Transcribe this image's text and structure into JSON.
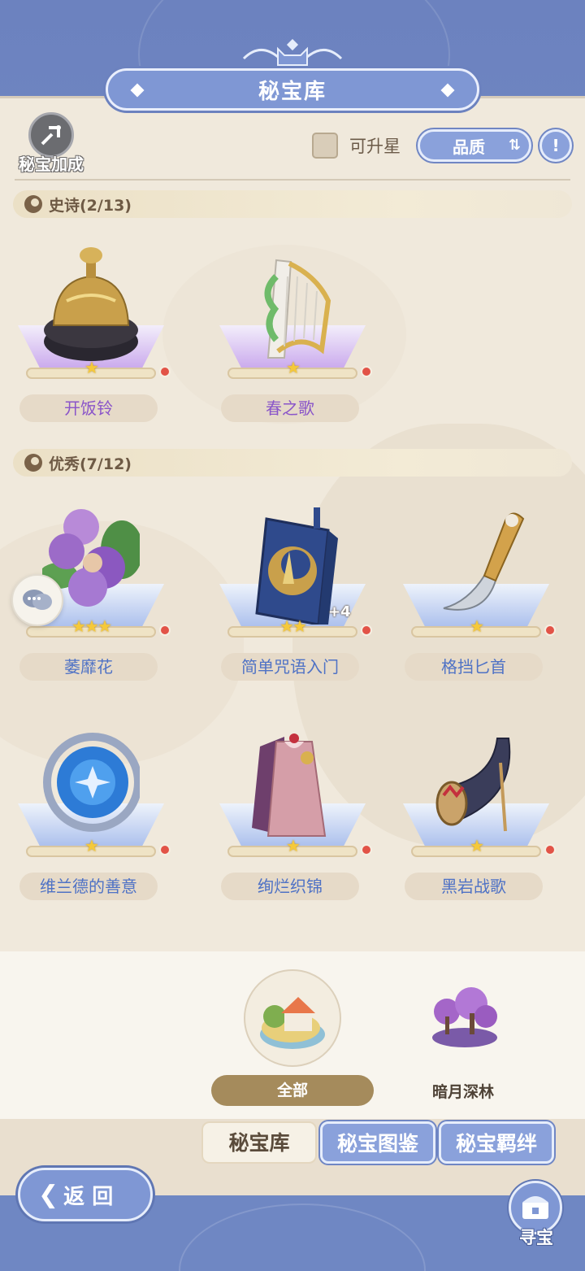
{
  "header": {
    "title": "秘宝库"
  },
  "toolbar": {
    "bonus_label": "秘宝加成",
    "upgradable_label": "可升星",
    "sort_label": "品质",
    "info_icon": "info-icon"
  },
  "sections": [
    {
      "label": "史诗(2/13)",
      "items": [
        {
          "name": "开饭铃",
          "stars": "★",
          "icon": "dinner-bell-icon",
          "rarity": "purple"
        },
        {
          "name": "春之歌",
          "stars": "★",
          "icon": "harp-icon",
          "rarity": "purple"
        }
      ]
    },
    {
      "label": "优秀(7/12)",
      "items": [
        {
          "name": "萎靡花",
          "stars": "★★★",
          "icon": "purple-flower-icon",
          "rarity": "blue"
        },
        {
          "name": "简单咒语入门",
          "stars": "★★",
          "icon": "spell-book-icon",
          "rarity": "blue",
          "extra": "+4"
        },
        {
          "name": "格挡匕首",
          "stars": "★",
          "icon": "dagger-icon",
          "rarity": "blue"
        },
        {
          "name": "维兰德的善意",
          "stars": "★",
          "icon": "blue-orb-icon",
          "rarity": "blue"
        },
        {
          "name": "绚烂织锦",
          "stars": "★",
          "icon": "dress-icon",
          "rarity": "blue"
        },
        {
          "name": "黑岩战歌",
          "stars": "★",
          "icon": "war-horn-icon",
          "rarity": "blue"
        }
      ]
    }
  ],
  "regions": [
    {
      "label": "全部",
      "selected": true,
      "icon": "house-island-icon"
    },
    {
      "label": "暗月深林",
      "selected": false,
      "icon": "purple-forest-icon"
    }
  ],
  "tabs": [
    "秘宝库",
    "秘宝图鉴",
    "秘宝羁绊"
  ],
  "footer": {
    "back_label": "返 回",
    "hunt_label": "寻宝"
  },
  "colors": {
    "accent_blue": "#8aa1db",
    "parchment": "#f0e9dc",
    "epic_purple": "#8a55c9",
    "rare_blue": "#4f72c5",
    "red_dot": "#e25347"
  }
}
